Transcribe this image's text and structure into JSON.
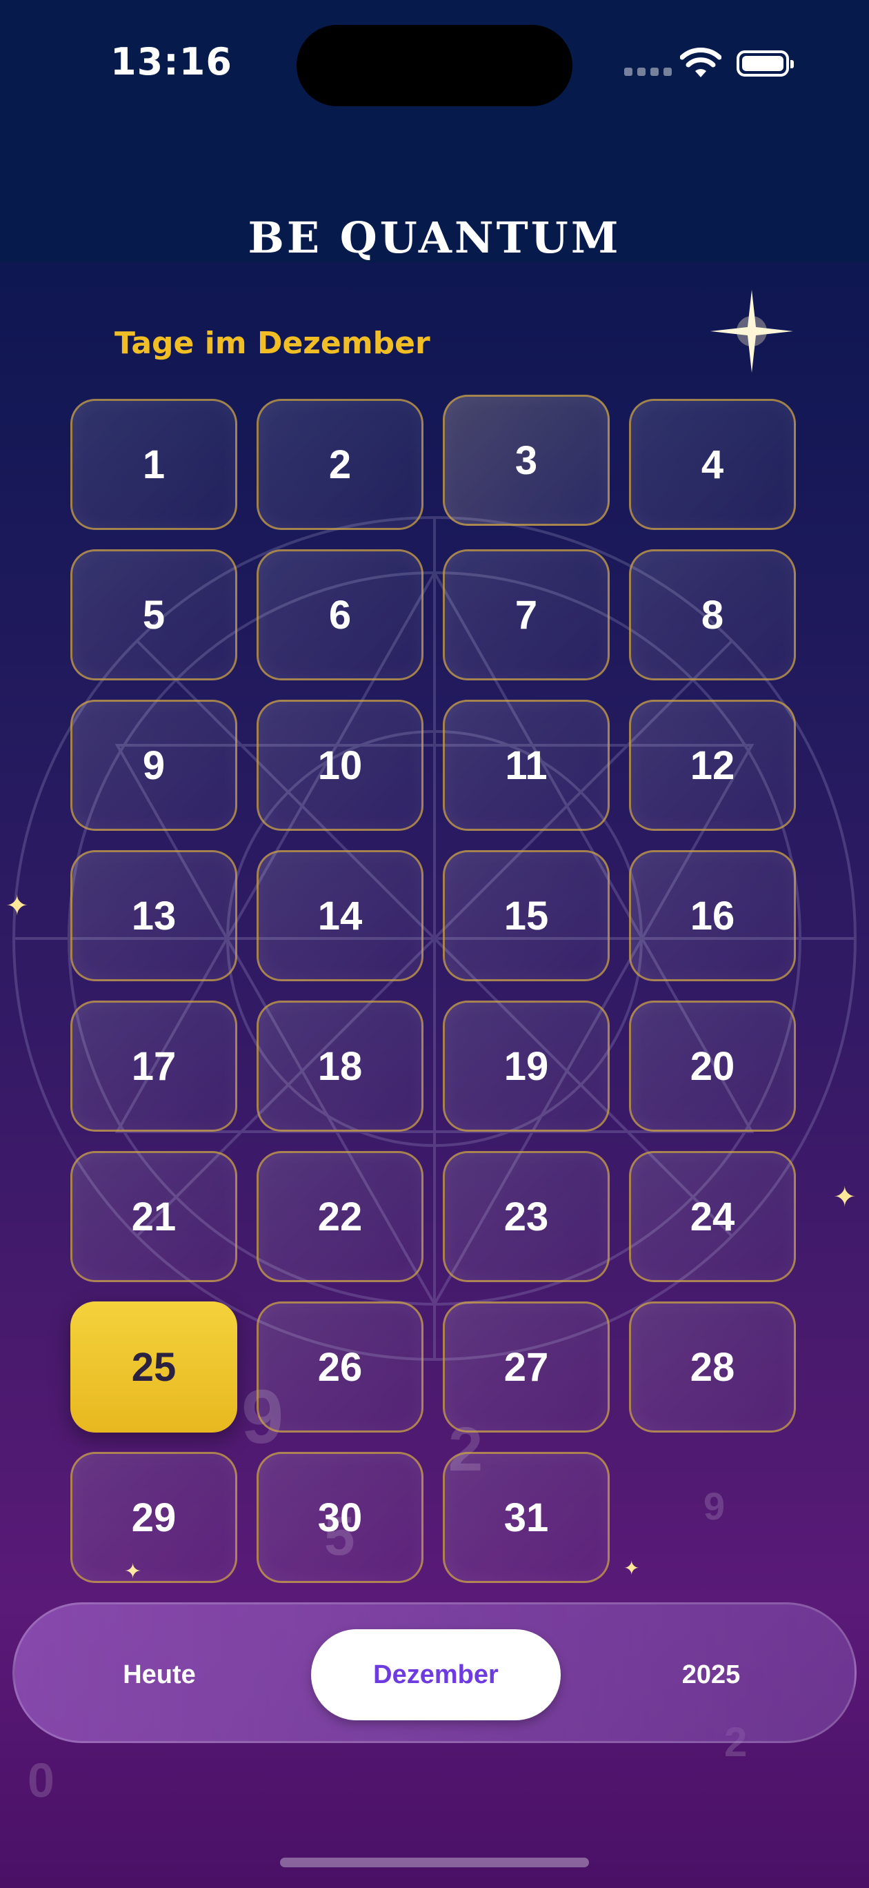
{
  "status_bar": {
    "time": "13:16"
  },
  "header": {
    "brand": "BE  QUANTUM"
  },
  "section": {
    "title": "Tage im Dezember"
  },
  "days": [
    "1",
    "2",
    "3",
    "4",
    "5",
    "6",
    "7",
    "8",
    "9",
    "10",
    "11",
    "12",
    "13",
    "14",
    "15",
    "16",
    "17",
    "18",
    "19",
    "20",
    "21",
    "22",
    "23",
    "24",
    "25",
    "26",
    "27",
    "28",
    "29",
    "30",
    "31"
  ],
  "selected_day": "25",
  "tabs": {
    "today": "Heute",
    "month": "Dezember",
    "year": "2025"
  },
  "colors": {
    "accent_gold": "#f2be25",
    "selected_tab_text": "#6d3be0",
    "border_gold": "#c9a046"
  },
  "icons": [
    "wifi-icon",
    "battery-icon",
    "sparkle-icon",
    "zodiac-wheel"
  ]
}
